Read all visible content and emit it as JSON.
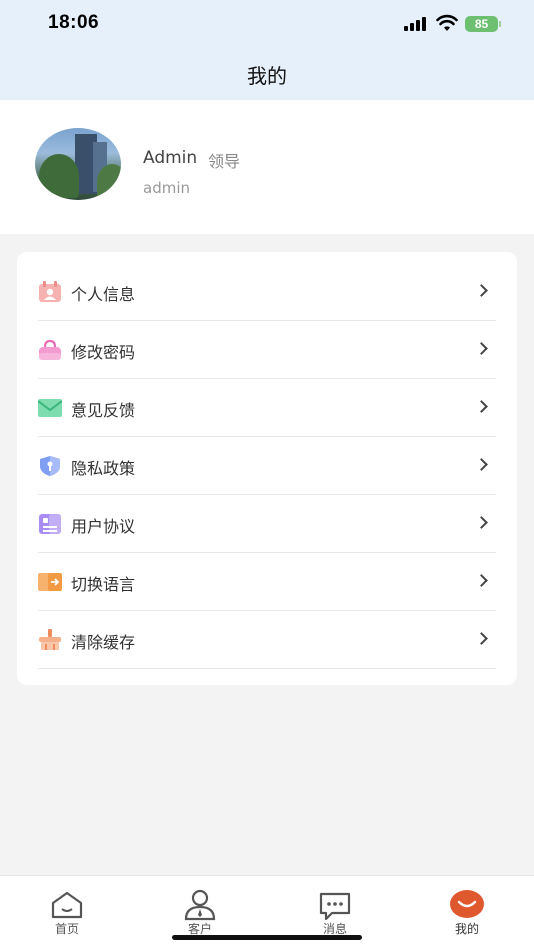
{
  "status_bar": {
    "time": "18:06",
    "battery": "85"
  },
  "header": {
    "title": "我的"
  },
  "profile": {
    "name": "Admin",
    "role": "领导",
    "account": "admin"
  },
  "menu": {
    "items": [
      {
        "label": "个人信息",
        "icon": "profile-card-icon",
        "color": "#f29a9a"
      },
      {
        "label": "修改密码",
        "icon": "lock-bag-icon",
        "color": "#f08ac6"
      },
      {
        "label": "意见反馈",
        "icon": "mail-icon",
        "color": "#5fcf9a"
      },
      {
        "label": "隐私政策",
        "icon": "shield-icon",
        "color": "#6d8ff0"
      },
      {
        "label": "用户协议",
        "icon": "document-icon",
        "color": "#9a7cf0"
      },
      {
        "label": "切换语言",
        "icon": "switch-icon",
        "color": "#f5a04a"
      },
      {
        "label": "清除缓存",
        "icon": "broom-icon",
        "color": "#f4a880"
      }
    ]
  },
  "tabbar": {
    "tabs": [
      {
        "label": "首页"
      },
      {
        "label": "客户"
      },
      {
        "label": "消息"
      },
      {
        "label": "我的"
      }
    ],
    "active_color": "#e0582e"
  }
}
